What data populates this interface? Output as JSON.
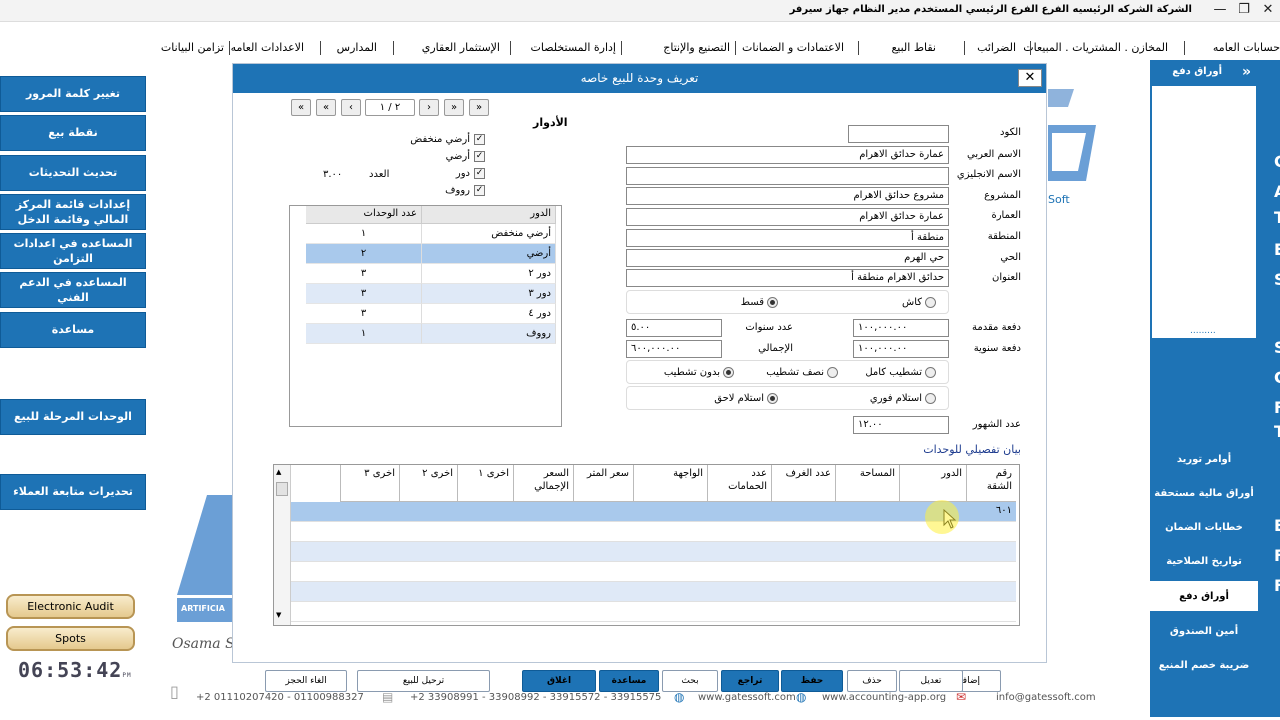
{
  "titlebar": {
    "info": "الشركة الشركه الرئيسيه   الفرع الفرع الرئيسي   المستخدم مدير النظام   جهاز سيرفر",
    "min": "—",
    "max": "❐",
    "close": "✕"
  },
  "menu": [
    "حسابات العامه",
    "المخازن . المشتريات . المبيعات",
    "الضرائب",
    "نقاط البيع",
    "الاعتمادات و الضمانات",
    "التصنيع والإنتاج",
    "إدارة المستخلصات",
    "الإستثمار العقاري",
    "المدارس",
    "الاعدادات العامه",
    "تزامن البيانات"
  ],
  "left_buttons": [
    "تغيير كلمة المرور",
    "نقطة بيع",
    "تحديث التحديثات",
    "إعدادات قائمة المركز المالي وقائمة الدخل",
    "المساعده في اعدادات التزامن",
    "المساعده في الدعم الفني",
    "مساعدة",
    "الوحدات المرحلة للبيع",
    "تحديرات متابعة العملاء"
  ],
  "gold_buttons": [
    "Electronic Audit",
    "Spots"
  ],
  "clock": {
    "time": "06:53:42",
    "ampm": "PM"
  },
  "bg": {
    "soft": "Soft",
    "artifici": "ARTIFICIA",
    "osama": "Osama S"
  },
  "right_sidebar": {
    "header": "أوراق دفع",
    "collapse": "«",
    "dots": ".........",
    "items": [
      "أوامر توريد",
      "أوراق مالية مستحقة",
      "خطابات الضمان",
      "تواريخ الصلاحية",
      "أوراق دفع",
      "أمين الصندوق",
      "ضريبة خصم المنبع"
    ],
    "active_index": 4,
    "edge_letters": [
      "C",
      "A",
      "T",
      "E",
      "S",
      "S",
      "C",
      "F",
      "T",
      "E",
      "F",
      "F"
    ]
  },
  "dialog": {
    "title": "تعريف وحدة للبيع خاصه",
    "close": "✕",
    "nav": {
      "first": "«",
      "prev_page": "«",
      "prev": "‹",
      "pos": "٢ / ١",
      "next": "›",
      "next_page": "»",
      "last": "»"
    },
    "fields": {
      "code_label": "الكود",
      "code": "",
      "name_ar_label": "الاسم العربي",
      "name_ar": "عمارة حدائق الاهرام",
      "name_en_label": "الاسم الانجليزي",
      "name_en": "",
      "project_label": "المشروع",
      "project": "مشروع حدائق الاهرام",
      "building_label": "العمارة",
      "building": "عمارة حدائق الاهرام",
      "zone_label": "المنطقة",
      "zone": "منطقة أ",
      "district_label": "الحي",
      "district": "حي الهرم",
      "address_label": "العنوان",
      "address": "حدائق الاهرام منطقة أ"
    },
    "payment": {
      "cash": "كاش",
      "installment": "قسط",
      "selected": "installment"
    },
    "down_payment_label": "دفعة مقدمة",
    "down_payment": "١٠٠,٠٠٠.٠٠",
    "years_label": "عدد سنوات",
    "years": "٥.٠٠",
    "annual_label": "دفعة سنوية",
    "annual": "١٠٠,٠٠٠.٠٠",
    "total_label": "الإجمالي",
    "total": "٦٠٠,٠٠٠.٠٠",
    "finishing": {
      "full": "تشطيب كامل",
      "half": "نصف تشطيب",
      "none": "بدون تشطيب",
      "selected": "none"
    },
    "delivery": {
      "now": "استلام فوري",
      "later": "استلام لاحق",
      "selected": "later"
    },
    "months_label": "عدد الشهور",
    "months": "١٢.٠٠",
    "floors_title": "الأدوار",
    "floor_checks": [
      "أرضي منخفض",
      "أرضي",
      "دور",
      "رووف"
    ],
    "count_label": "العدد",
    "count": "٣.٠٠",
    "floors_grid": {
      "headers": [
        "الدور",
        "عدد الوحدات"
      ],
      "rows": [
        [
          "أرضي منخفض",
          "١"
        ],
        [
          "أرضي",
          "٢"
        ],
        [
          "دور ٢",
          "٣"
        ],
        [
          "دور ٣",
          "٣"
        ],
        [
          "دور ٤",
          "٣"
        ],
        [
          "رووف",
          "١"
        ]
      ],
      "selected": 1
    },
    "units_title": "بيان تفصيلي للوحدات",
    "units_grid": {
      "headers": [
        "رقم الشقة",
        "الدور",
        "المساحة",
        "عدد الغرف",
        "عدد الحمامات",
        "الواجهة",
        "سعر المتر",
        "السعر الإجمالي",
        "اخرى ١",
        "اخرى ٢",
        "اخرى ٣"
      ],
      "rows": [
        [
          "٦٠١",
          "",
          "",
          "",
          "",
          "",
          "",
          "",
          "",
          "",
          ""
        ]
      ]
    },
    "buttons": [
      "إضافة",
      "تعديل",
      "حذف",
      "حفظ",
      "تراجع",
      "بحث",
      "مساعدة",
      "اغلاق",
      "ترحيل للبيع",
      "الغاء الحجز"
    ]
  },
  "footer": {
    "phone1": "+2 01110207420 - 01100988327",
    "phone2": "+2 33908991 - 33908992 - 33915572 - 33915575",
    "site1": "www.gatessoft.com",
    "site2": "www.accounting-app.org",
    "email": "info@gatessoft.com"
  },
  "colors": {
    "accent": "#1e73b5",
    "selected_row": "#a9c9ec",
    "stripe": "#dfe9f7"
  }
}
